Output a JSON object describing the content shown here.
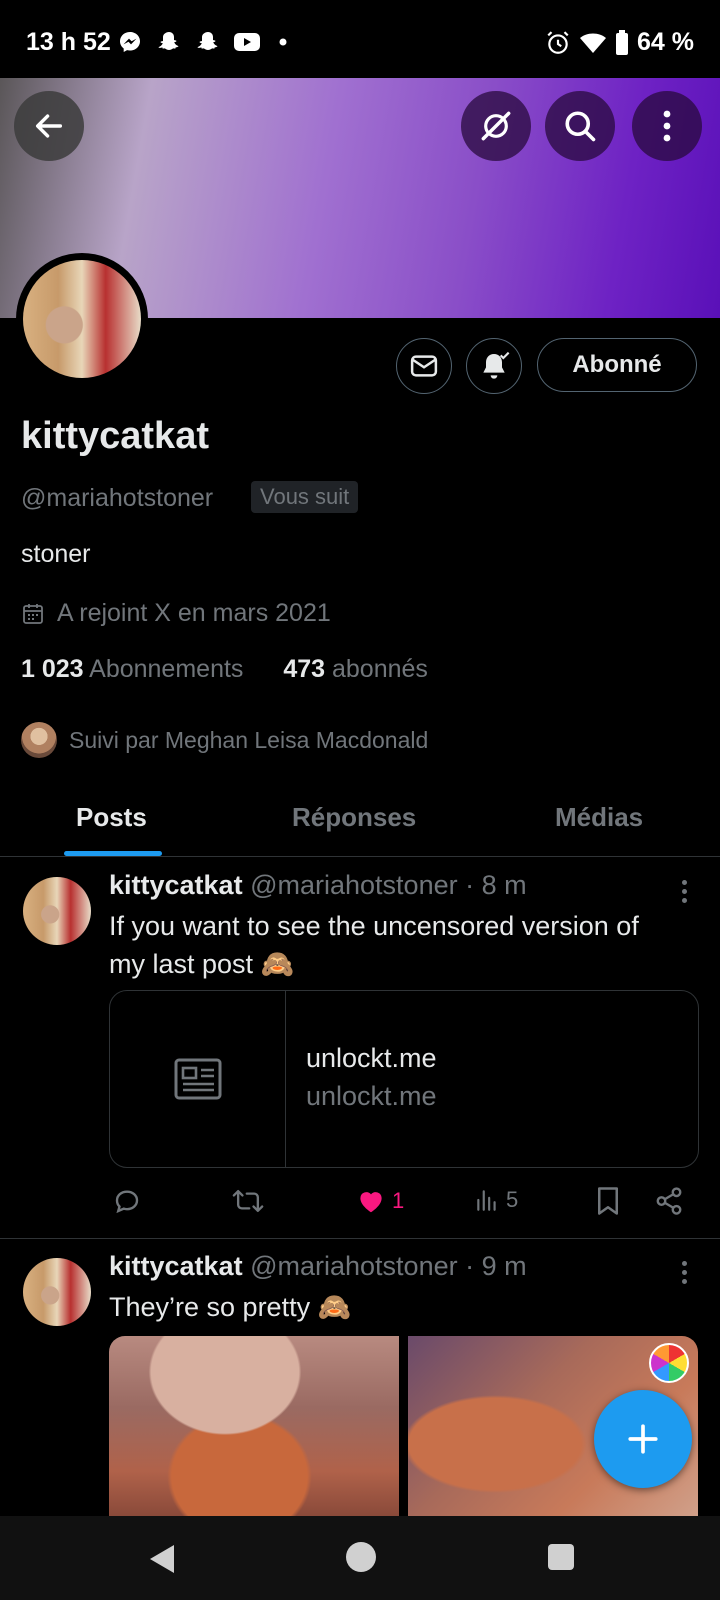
{
  "status_bar": {
    "time": "13 h 52",
    "battery": "64 %",
    "left_icons": [
      "messenger-icon",
      "snapchat-icon",
      "snapchat-icon",
      "youtube-icon",
      "dot-icon"
    ],
    "right_icons": [
      "alarm-icon",
      "wifi-icon",
      "battery-icon"
    ]
  },
  "profile": {
    "display_name": "kittycatkat",
    "handle": "@mariahotstoner",
    "follows_you": "Vous suit",
    "bio": "stoner",
    "joined": "A rejoint X en mars 2021",
    "following_count": "1 023",
    "following_label": "Abonnements",
    "followers_count": "473",
    "followers_label": "abonnés",
    "followed_by": "Suivi par Meghan Leisa Macdonald",
    "follow_button": "Abonné"
  },
  "tabs": [
    {
      "label": "Posts",
      "active": true
    },
    {
      "label": "Réponses",
      "active": false
    },
    {
      "label": "Médias",
      "active": false
    }
  ],
  "posts": [
    {
      "author": "kittycatkat",
      "handle": "@mariahotstoner",
      "time": "· 8 m",
      "text_line1": "If you want to see the uncensored version of",
      "text_line2": "my last post 🙈",
      "card": {
        "title": "unlockt.me",
        "domain": "unlockt.me"
      },
      "likes": "1",
      "views": "5"
    },
    {
      "author": "kittycatkat",
      "handle": "@mariahotstoner",
      "time": "· 9 m",
      "text_line1": "They’re so pretty 🙈"
    }
  ],
  "colors": {
    "accent": "#1d9bf0",
    "like": "#f91880",
    "muted": "#71767b",
    "background": "#000000"
  }
}
